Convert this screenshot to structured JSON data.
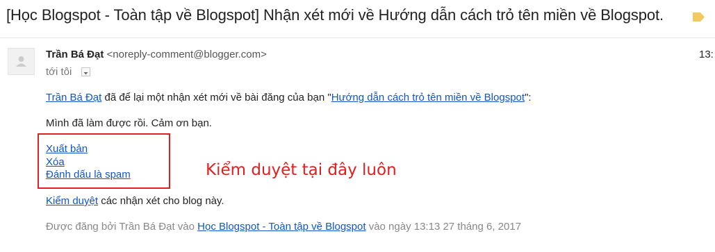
{
  "email": {
    "subject": "[Học Blogspot - Toàn tập về Blogspot] Nhận xét mới về Hướng dẫn cách trỏ tên miền về Blogspot.",
    "label_icon": "label-tag-icon",
    "label_color": "#f2c960",
    "sender_name": "Trần Bá Đạt",
    "sender_email": "<noreply-comment@blogger.com>",
    "time": "13:",
    "recipient": "tới tôi",
    "body": {
      "author_link": "Trần Bá Đạt",
      "intro_text": " đã để lại một nhận xét mới về bài đăng của bạn \"",
      "post_link": "Hướng dẫn cách trỏ tên miền về Blogspot",
      "intro_end": "\":",
      "comment": "Mình đã làm được rồi. Cảm ơn bạn.",
      "actions": [
        "Xuất bản",
        "Xóa",
        "Đánh dấu là spam"
      ],
      "moderate_link": "Kiểm duyệt",
      "moderate_text": " các nhận xét cho blog này.",
      "footer_prefix": "Được đăng bởi Trần Bá Đạt vào ",
      "footer_blog_link": "Học Blogspot - Toàn tập về Blogspot",
      "footer_suffix": " vào ngày 13:13 27 tháng 6, 2017"
    }
  },
  "annotation": {
    "text": "Kiểm duyệt tại đây luôn",
    "color": "#e02020"
  }
}
